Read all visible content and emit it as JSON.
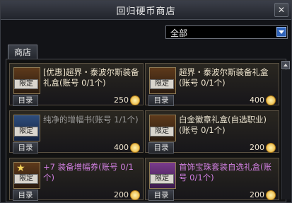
{
  "window": {
    "title": "回归硬币商店",
    "close": "✕"
  },
  "filter": {
    "selected": "全部"
  },
  "tabs": [
    {
      "label": "商店"
    }
  ],
  "items": [
    {
      "name": "[优惠]超界・泰波尔斯装备礼盒(账号 0/1个)",
      "badge": "限定",
      "menu": "目录",
      "price": "250"
    },
    {
      "name": "超界・泰波尔斯装备礼盒(账号 0/1个)",
      "badge": "限定",
      "menu": "目录",
      "price": "400"
    },
    {
      "name": "纯净的增幅书(账号 1/1个)",
      "badge": "限定",
      "menu": "目录",
      "price": "400"
    },
    {
      "name": "白金徽章礼盒(自选职业)(账号 0/1个)",
      "badge": "限定",
      "menu": "目录",
      "price": "200"
    },
    {
      "name": "+7 装备增幅券(账号 0/1个)",
      "badge": "限定",
      "menu": "目录",
      "price": "200"
    },
    {
      "name": "首饰宝珠套装自选礼盒(账号 0/1个)",
      "badge": "限定",
      "menu": "目录",
      "price": "200"
    }
  ]
}
